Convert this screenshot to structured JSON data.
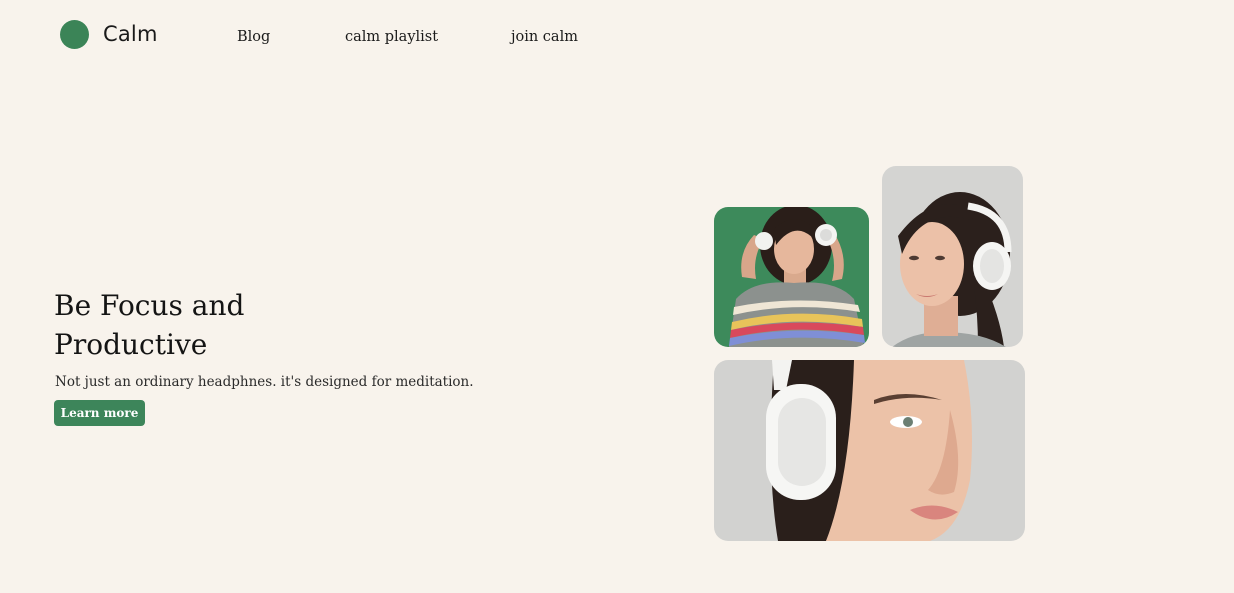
{
  "brand": {
    "name": "Calm",
    "accent_color": "#3b8457"
  },
  "nav": {
    "links": [
      {
        "label": "Blog"
      },
      {
        "label": "calm playlist"
      },
      {
        "label": "join calm"
      }
    ]
  },
  "hero": {
    "title": "Be Focus and Productive",
    "subtitle": "Not just an ordinary headphnes. it's designed for meditation.",
    "cta_label": "Learn more"
  },
  "gallery": {
    "images": [
      {
        "icon": "woman-with-headphones-green-background-photo"
      },
      {
        "icon": "woman-wearing-headphones-profile-photo"
      },
      {
        "icon": "woman-headphones-closeup-photo"
      }
    ]
  }
}
